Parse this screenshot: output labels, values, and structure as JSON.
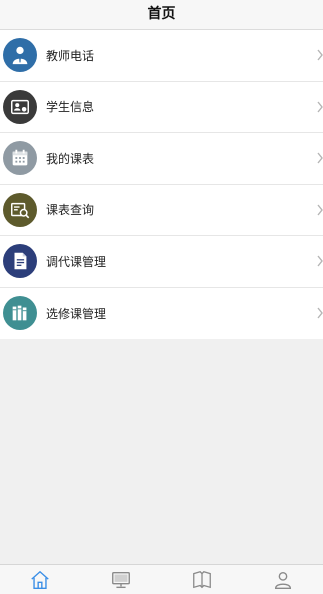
{
  "header": {
    "title": "首页"
  },
  "menu": {
    "items": [
      {
        "label": "教师电话",
        "icon": "teacher-phone-icon",
        "color": "#2f6ea8"
      },
      {
        "label": "学生信息",
        "icon": "student-info-icon",
        "color": "#3a3a3a"
      },
      {
        "label": "我的课表",
        "icon": "my-schedule-icon",
        "color": "#8f9aa3"
      },
      {
        "label": "课表查询",
        "icon": "schedule-search-icon",
        "color": "#5d5a2c"
      },
      {
        "label": "调代课管理",
        "icon": "substitute-management-icon",
        "color": "#2c3e7a"
      },
      {
        "label": "选修课管理",
        "icon": "elective-management-icon",
        "color": "#3f8f92"
      }
    ]
  },
  "tabbar": {
    "tabs": [
      {
        "icon": "home-icon",
        "active": true
      },
      {
        "icon": "computer-icon",
        "active": false
      },
      {
        "icon": "book-icon",
        "active": false
      },
      {
        "icon": "profile-icon",
        "active": false
      }
    ],
    "active_color": "#3a8ee6",
    "inactive_color": "#8a8a8a"
  }
}
